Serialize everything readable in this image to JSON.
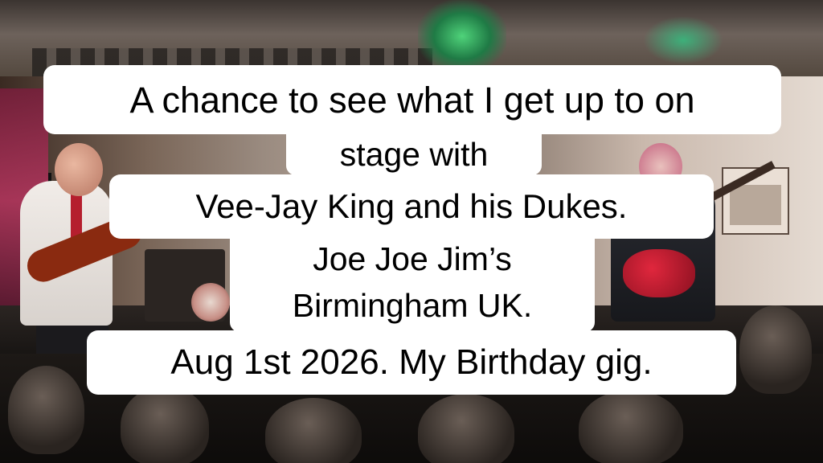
{
  "caption": {
    "line1": "A chance to see what I get up to on",
    "line2": "stage with",
    "line3": "Vee-Jay King and his Dukes.",
    "line4": "Joe Joe Jim’s",
    "line5": "Birmingham UK.",
    "line6": "Aug 1st 2026. My Birthday gig."
  },
  "colors": {
    "caption_bg": "#ffffff",
    "caption_text": "#000000",
    "stage_green_light": "#4fd37a",
    "bass_guitar_red": "#e0273d"
  }
}
